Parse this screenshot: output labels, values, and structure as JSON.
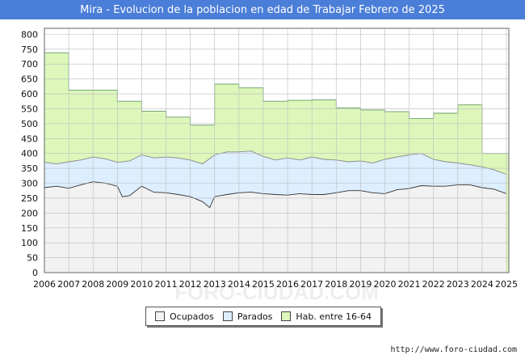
{
  "page": {
    "title": "Mira - Evolucion de la poblacion en edad de Trabajar Febrero de 2025",
    "source": "http://www.foro-ciudad.com",
    "watermark": "FORO-CIUDAD.COM"
  },
  "chart_data": {
    "type": "area",
    "title": "Mira - Evolucion de la poblacion en edad de Trabajar Febrero de 2025",
    "xlabel": "",
    "ylabel": "",
    "xlim": [
      2006,
      2025.1
    ],
    "ylim": [
      0,
      820
    ],
    "yticks": [
      0,
      50,
      100,
      150,
      200,
      250,
      300,
      350,
      400,
      450,
      500,
      550,
      600,
      650,
      700,
      750,
      800
    ],
    "xticks": [
      2006,
      2007,
      2008,
      2009,
      2010,
      2011,
      2012,
      2013,
      2014,
      2015,
      2016,
      2017,
      2018,
      2019,
      2020,
      2021,
      2022,
      2023,
      2024,
      2025
    ],
    "grid": true,
    "legend_position": "bottom",
    "series": [
      {
        "name": "Ocupados",
        "color": "#f2f2f2",
        "stroke": "#333333",
        "x": [
          2006.0,
          2006.5,
          2007.0,
          2007.5,
          2008.0,
          2008.5,
          2009.0,
          2009.2,
          2009.5,
          2010.0,
          2010.5,
          2011.0,
          2011.5,
          2012.0,
          2012.5,
          2012.8,
          2013.0,
          2013.5,
          2014.0,
          2014.5,
          2015.0,
          2015.5,
          2016.0,
          2016.5,
          2017.0,
          2017.5,
          2018.0,
          2018.5,
          2019.0,
          2019.5,
          2020.0,
          2020.5,
          2021.0,
          2021.5,
          2022.0,
          2022.5,
          2023.0,
          2023.5,
          2024.0,
          2024.5,
          2025.0
        ],
        "values": [
          285,
          290,
          283,
          295,
          305,
          300,
          290,
          255,
          258,
          290,
          270,
          268,
          262,
          255,
          238,
          218,
          255,
          262,
          268,
          270,
          265,
          262,
          260,
          265,
          262,
          262,
          268,
          275,
          275,
          268,
          265,
          278,
          282,
          292,
          290,
          290,
          295,
          295,
          285,
          280,
          265
        ]
      },
      {
        "name": "Parados",
        "color": "#ddeeff",
        "stroke": "#888888",
        "x": [
          2006.0,
          2006.5,
          2007.0,
          2007.5,
          2008.0,
          2008.5,
          2009.0,
          2009.5,
          2010.0,
          2010.5,
          2011.0,
          2011.5,
          2012.0,
          2012.5,
          2013.0,
          2013.5,
          2014.0,
          2014.5,
          2015.0,
          2015.5,
          2016.0,
          2016.5,
          2017.0,
          2017.5,
          2018.0,
          2018.5,
          2019.0,
          2019.5,
          2020.0,
          2020.5,
          2021.0,
          2021.5,
          2022.0,
          2022.5,
          2023.0,
          2023.5,
          2024.0,
          2024.5,
          2025.0
        ],
        "values": [
          370,
          365,
          372,
          378,
          388,
          382,
          370,
          375,
          395,
          385,
          388,
          385,
          378,
          365,
          395,
          405,
          405,
          408,
          390,
          378,
          385,
          378,
          388,
          380,
          378,
          372,
          375,
          368,
          380,
          388,
          395,
          400,
          380,
          372,
          368,
          362,
          355,
          345,
          330
        ]
      },
      {
        "name": "Hab. entre 16-64",
        "color": "#ddf7bb",
        "stroke": "#669966",
        "step": true,
        "x": [
          2006,
          2007,
          2008,
          2009,
          2010,
          2011,
          2012,
          2013,
          2014,
          2015,
          2016,
          2017,
          2018,
          2019,
          2020,
          2021,
          2022,
          2023,
          2024
        ],
        "values": [
          738,
          612,
          612,
          575,
          542,
          522,
          495,
          633,
          620,
          575,
          578,
          580,
          553,
          546,
          540,
          517,
          535,
          563,
          400
        ]
      }
    ]
  },
  "legend": {
    "items": [
      {
        "label": "Ocupados",
        "color": "#f2f2f2"
      },
      {
        "label": "Parados",
        "color": "#ddeeff"
      },
      {
        "label": "Hab. entre 16-64",
        "color": "#ddf7bb"
      }
    ]
  }
}
